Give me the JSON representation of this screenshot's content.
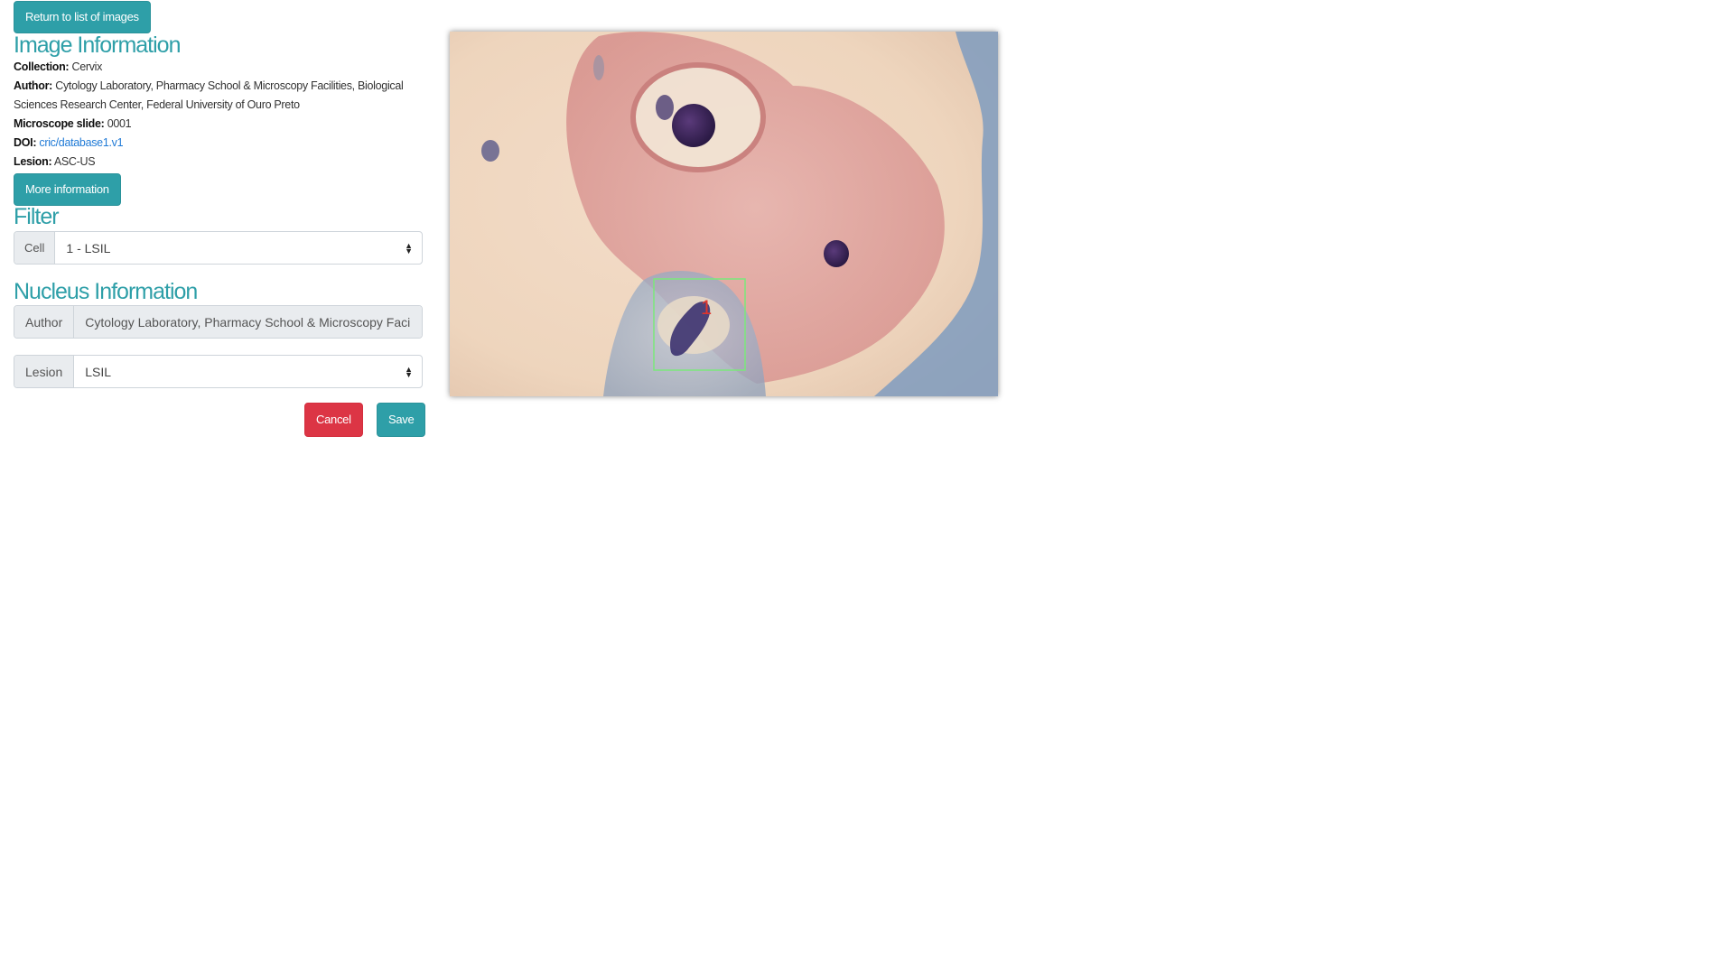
{
  "nav": {
    "return_label": "Return to list of images"
  },
  "image_info": {
    "title": "Image Information",
    "collection_label": "Collection:",
    "collection_value": "Cervix",
    "author_label": "Author:",
    "author_value": "Cytology Laboratory, Pharmacy School & Microscopy Facilities, Biological Sciences Research Center, Federal University of Ouro Preto",
    "slide_label": "Microscope slide:",
    "slide_value": "0001",
    "doi_label": "DOI:",
    "doi_value": "cric/database1.v1",
    "lesion_label": "Lesion:",
    "lesion_value": "ASC-US",
    "more_label": "More information"
  },
  "filter": {
    "title": "Filter",
    "cell_label": "Cell",
    "cell_selected": "1 - LSIL"
  },
  "nucleus": {
    "title": "Nucleus Information",
    "author_label": "Author",
    "author_value": "Cytology Laboratory, Pharmacy School & Microscopy Facilities, Biological Sciences Research Center, Federal University of Ouro Preto",
    "lesion_label": "Lesion",
    "lesion_selected": "LSIL"
  },
  "actions": {
    "cancel_label": "Cancel",
    "save_label": "Save"
  },
  "viewer": {
    "annotation_label": "1",
    "annotation_color": "#7be87b"
  },
  "colors": {
    "accent": "#2e9fa8",
    "danger": "#dc3545",
    "link": "#1f7ad6"
  }
}
